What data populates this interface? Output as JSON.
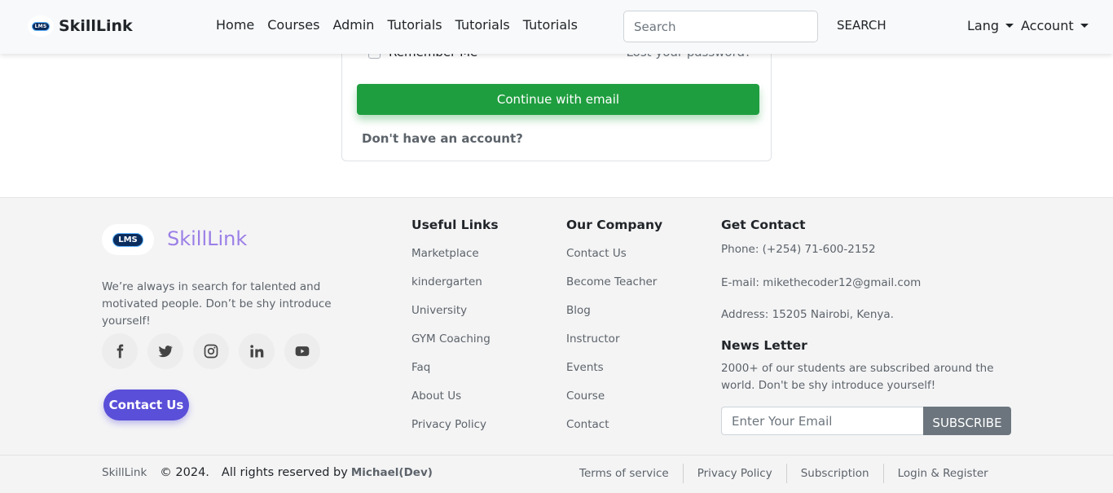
{
  "navbar": {
    "brand": "SkillLink",
    "logo_text": "LMS",
    "links": [
      "Home",
      "Courses",
      "Admin",
      "Tutorials",
      "Tutorials",
      "Tutorials"
    ],
    "search_placeholder": "Search",
    "search_button": "SEARCH",
    "lang_label": "Lang",
    "account_label": "Account"
  },
  "login": {
    "remember_label": "Remember Me",
    "lost_password": "Lost your password?",
    "continue_button": "Continue with email",
    "no_account": "Don't have an account?"
  },
  "footer": {
    "brand": "SkillLink",
    "logo_text": "LMS",
    "about": "We’re always in search for talented and motivated people. Don’t be shy introduce yourself!",
    "socials": [
      "facebook-icon",
      "twitter-icon",
      "instagram-icon",
      "linkedin-icon",
      "youtube-icon"
    ],
    "contact_button": "Contact Us",
    "useful_links": {
      "title": "Useful Links",
      "items": [
        "Marketplace",
        "kindergarten",
        "University",
        "GYM Coaching",
        "Faq",
        "About Us",
        "Privacy Policy"
      ]
    },
    "company": {
      "title": "Our Company",
      "items": [
        "Contact Us",
        "Become Teacher",
        "Blog",
        "Instructor",
        "Events",
        "Course",
        "Contact"
      ]
    },
    "contact": {
      "title": "Get Contact",
      "phone": "Phone: (+254) 71-600-2152",
      "email": "E-mail: mikethecoder12@gmail.com",
      "address": "Address: 15205 Nairobi, Kenya."
    },
    "newsletter": {
      "title": "News Letter",
      "text": "2000+ of our students are subscribed around the world. Don't be shy introduce yourself!",
      "email_placeholder": "Enter Your Email",
      "subscribe_button": "SUBSCRIBE"
    },
    "bottom": {
      "brand": "SkillLink",
      "year": "© 2024.",
      "rights": "All rights reserved by",
      "author": "Michael(Dev)",
      "links": [
        "Terms of service",
        "Privacy Policy",
        "Subscription",
        "Login & Register"
      ]
    }
  }
}
